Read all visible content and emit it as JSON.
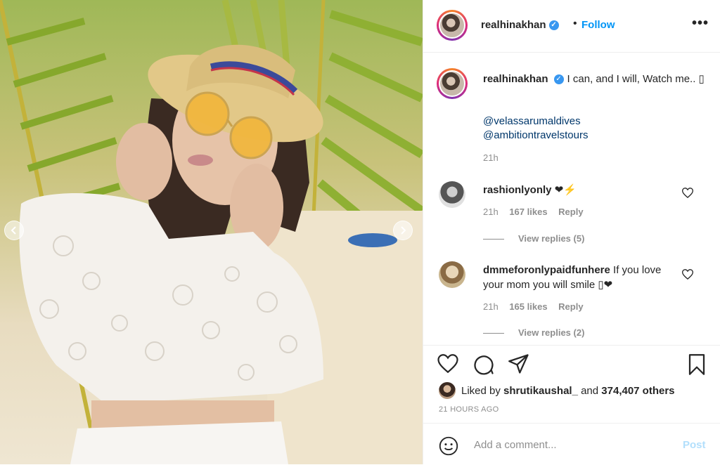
{
  "post": {
    "username": "realhinakhan",
    "follow_separator": "•",
    "follow_label": "Follow",
    "more_label": "•••"
  },
  "caption": {
    "username": "realhinakhan",
    "text": "I can, and I will, Watch me.. ▯",
    "mentions": [
      "@velassarumaldives",
      "@ambitiontravelstours"
    ],
    "time": "21h"
  },
  "comments": [
    {
      "username": "rashionlyonly",
      "text": "❤⚡",
      "time": "21h",
      "likes": "167 likes",
      "reply": "Reply",
      "view_replies": "View replies (5)"
    },
    {
      "username": "dmmeforonlypaidfunhere",
      "text": "If you love your mom you will smile ▯❤",
      "time": "21h",
      "likes": "165 likes",
      "reply": "Reply",
      "view_replies": "View replies (2)"
    }
  ],
  "likes": {
    "prefix": "Liked by",
    "user": "shrutikaushal_",
    "connector": "and",
    "others": "374,407 others"
  },
  "timestamp": "21 HOURS AGO",
  "composer": {
    "placeholder": "Add a comment...",
    "post_label": "Post"
  },
  "icons": {
    "verified": "verified-badge-icon",
    "like": "heart-icon",
    "comment": "comment-bubble-icon",
    "share": "paper-plane-icon",
    "save": "bookmark-icon",
    "emoji": "smiley-icon"
  },
  "colors": {
    "accent": "#0095f6",
    "verified": "#3897f0",
    "post_disabled": "#b2dffc",
    "secondary_text": "#8e8e8e"
  }
}
